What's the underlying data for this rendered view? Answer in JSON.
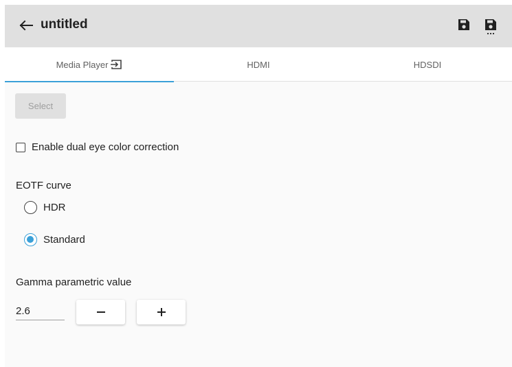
{
  "header": {
    "back_icon": "arrow-left-icon",
    "title": "untitled",
    "save_icon": "save-icon",
    "save_as_icon": "save-as-icon"
  },
  "tabs": [
    {
      "label": "Media Player",
      "active": true,
      "icon": "input-icon"
    },
    {
      "label": "HDMI",
      "active": false
    },
    {
      "label": "HDSDI",
      "active": false
    }
  ],
  "main": {
    "select_label": "Select",
    "dual_eye_label": "Enable dual eye color correction",
    "dual_eye_checked": false,
    "eotf_label": "EOTF curve",
    "eotf_options": [
      {
        "label": "HDR",
        "checked": false
      },
      {
        "label": "Standard",
        "checked": true
      }
    ],
    "gamma_label": "Gamma parametric value",
    "gamma_value": "2.6",
    "decrement_icon": "minus-icon",
    "increment_icon": "plus-icon"
  },
  "colors": {
    "accent": "#3aa0d8",
    "header_bg": "#e0e0e0",
    "background": "#fafafa"
  }
}
